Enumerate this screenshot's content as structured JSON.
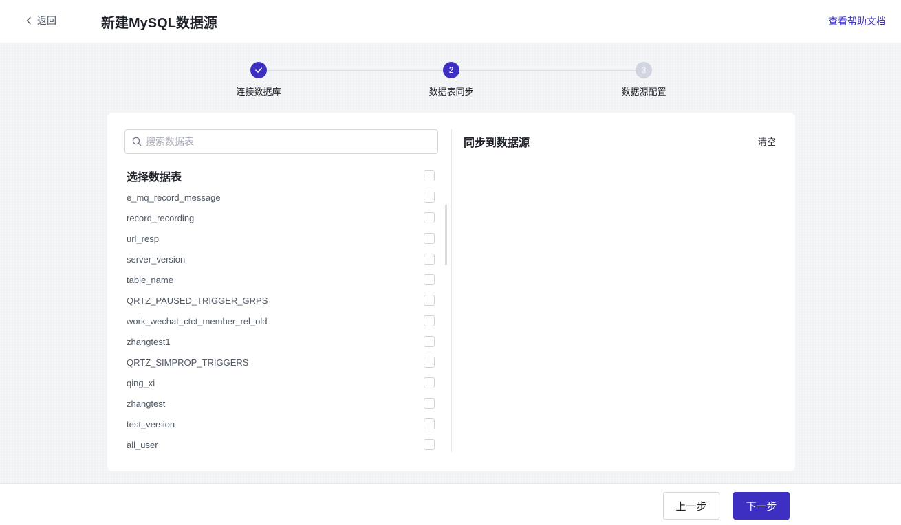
{
  "header": {
    "back_label": "返回",
    "title": "新建MySQL数据源",
    "help_link": "查看帮助文档"
  },
  "steps": [
    {
      "label": "连接数据库",
      "number": "1",
      "status": "done"
    },
    {
      "label": "数据表同步",
      "number": "2",
      "status": "active"
    },
    {
      "label": "数据源配置",
      "number": "3",
      "status": "pending"
    }
  ],
  "left": {
    "search_placeholder": "搜索数据表",
    "list_title": "选择数据表",
    "tables": [
      "e_mq_record_message",
      "record_recording",
      "url_resp",
      "server_version",
      "table_name",
      "QRTZ_PAUSED_TRIGGER_GRPS",
      "work_wechat_ctct_member_rel_old",
      "zhangtest1",
      "QRTZ_SIMPROP_TRIGGERS",
      "qing_xi",
      "zhangtest",
      "test_version",
      "all_user"
    ]
  },
  "right": {
    "title": "同步到数据源",
    "clear_label": "清空"
  },
  "footer": {
    "prev_label": "上一步",
    "next_label": "下一步"
  },
  "colors": {
    "accent": "#3d2fc2",
    "pending_step": "#d0d5e0"
  }
}
